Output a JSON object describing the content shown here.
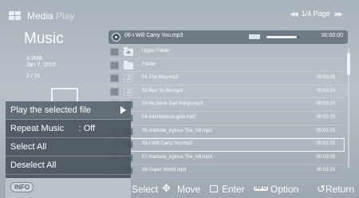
{
  "header": {
    "brand_main": "Media",
    "brand_sub": "Play",
    "page": "1/4 Page"
  },
  "info": {
    "category": "Music",
    "size": "4.3MB",
    "date": "Jan 7, 2010",
    "count": "2 / 31"
  },
  "now_playing": {
    "title": "06-I Will Carry You.mp3",
    "time": "00:00:00",
    "progress": 0.9
  },
  "files": [
    {
      "name": "Upper Folder",
      "type": "upper-folder",
      "duration": ""
    },
    {
      "name": "Folder",
      "type": "folder",
      "duration": ""
    },
    {
      "name": "01-The Way.mp3",
      "type": "music",
      "duration": "00:03:25"
    },
    {
      "name": "02-Run To Me.mp3",
      "type": "music",
      "duration": "00:03:25"
    },
    {
      "name": "03-No More Sad Songs.mp3",
      "type": "music",
      "duration": "00:03:25"
    },
    {
      "name": "04-Interference-gold.mp3",
      "type": "music",
      "duration": "00:03:25"
    },
    {
      "name": "05-marketa_irglova-The_hill.mp3",
      "type": "music",
      "duration": "00:03:25"
    },
    {
      "name": "06-I Will Carry You.mp3",
      "type": "music",
      "duration": "00:03:25",
      "selected": true
    },
    {
      "name": "07-marketa_irglova-The_hill.mp3",
      "type": "music",
      "duration": "00:03:25"
    },
    {
      "name": "08-Super World.mp3",
      "type": "music",
      "duration": "00:03:25"
    }
  ],
  "menu": {
    "items": [
      "Play the selected file",
      "Repeat Music      : Off",
      "Select All",
      "Deselect All"
    ],
    "info_label": "INFO"
  },
  "help": {
    "select": "Select",
    "move": "Move",
    "enter": "Enter",
    "info_key": "INFO",
    "option": "Option",
    "return": "Return"
  }
}
